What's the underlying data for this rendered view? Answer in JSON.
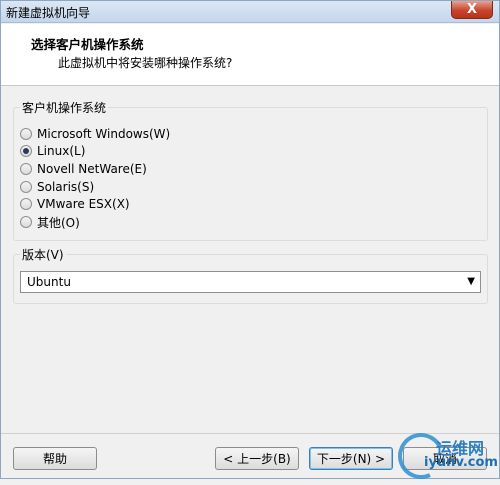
{
  "window": {
    "title": "新建虚拟机向导",
    "close_glyph": "X"
  },
  "header": {
    "title": "选择客户机操作系统",
    "subtitle": "此虚拟机中将安装哪种操作系统?"
  },
  "os_group": {
    "label": "客户机操作系统",
    "options": [
      {
        "label": "Microsoft Windows(W)",
        "selected": false
      },
      {
        "label": "Linux(L)",
        "selected": true
      },
      {
        "label": "Novell NetWare(E)",
        "selected": false
      },
      {
        "label": "Solaris(S)",
        "selected": false
      },
      {
        "label": "VMware ESX(X)",
        "selected": false
      },
      {
        "label": "其他(O)",
        "selected": false
      }
    ]
  },
  "version_group": {
    "label": "版本(V)",
    "selected": "Ubuntu",
    "arrow_glyph": "▼"
  },
  "buttons": {
    "help": "帮助",
    "back": "< 上一步(B)",
    "next": "下一步(N) >",
    "cancel": "取消"
  },
  "watermark": {
    "name": "运维网",
    "url": "iyunv.com"
  }
}
